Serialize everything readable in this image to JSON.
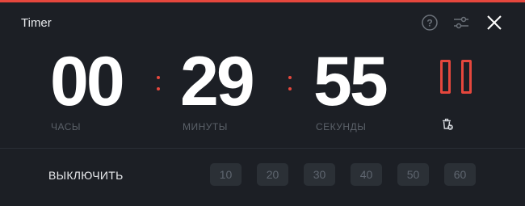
{
  "window": {
    "title": "Timer"
  },
  "header": {
    "icons": [
      {
        "name": "help-icon"
      },
      {
        "name": "settings-sliders-icon"
      },
      {
        "name": "close-icon"
      }
    ]
  },
  "timer": {
    "hours": "00",
    "minutes": "29",
    "seconds": "55",
    "hours_label": "ЧАСЫ",
    "minutes_label": "МИНУТЫ",
    "seconds_label": "СЕКУНДЫ",
    "accent_color": "#e5473d"
  },
  "controls": {
    "pause_icon": "pause-icon",
    "clear_icon": "trash-icon"
  },
  "shutdown": {
    "label": "ВЫКЛЮЧИТЬ",
    "presets": [
      "10",
      "20",
      "30",
      "40",
      "50",
      "60"
    ]
  }
}
